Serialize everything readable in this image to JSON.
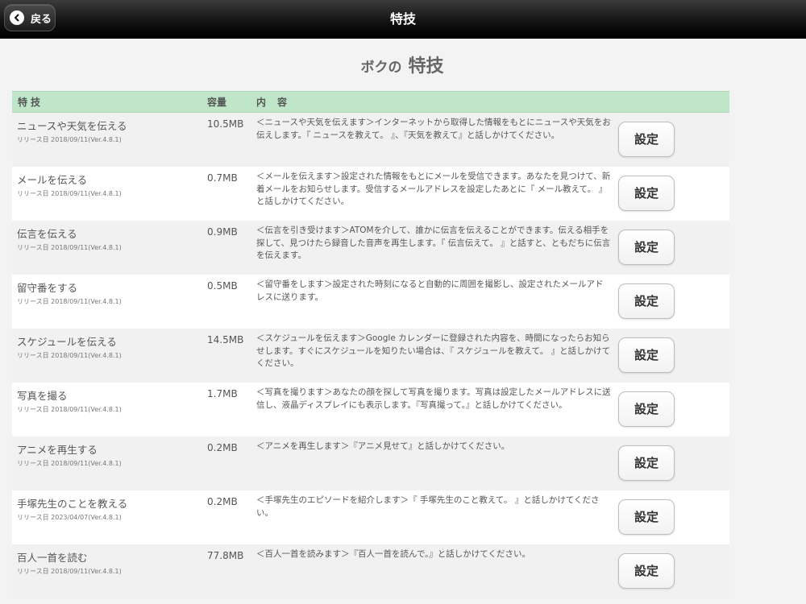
{
  "header": {
    "back_label": "戻る",
    "title": "特技"
  },
  "page_heading": {
    "sub": "ボクの",
    "main": "特技"
  },
  "table": {
    "columns": {
      "name": "特技",
      "size": "容量",
      "desc": "内容"
    },
    "setting_label": "設定",
    "rows": [
      {
        "name": "ニュースや天気を伝える",
        "release": "リリース日 2018/09/11(Ver.4.8.1)",
        "size": "10.5MB",
        "desc": "＜ニュースや天気を伝えます＞インターネットから取得した情報をもとにニュースや天気をお伝えします。『 ニュースを教えて。 』、『天気を教えて』と話しかけてください。"
      },
      {
        "name": "メールを伝える",
        "release": "リリース日 2018/09/11(Ver.4.8.1)",
        "size": "0.7MB",
        "desc": "＜メールを伝えます＞設定された情報をもとにメールを受信できます。あなたを見つけて、新着メールをお知らせします。受信するメールアドレスを設定したあとに『 メール教えて。 』と話しかけてください。"
      },
      {
        "name": "伝言を伝える",
        "release": "リリース日 2018/09/11(Ver.4.8.1)",
        "size": "0.9MB",
        "desc": "＜伝言を引き受けます＞ATOMを介して、誰かに伝言を伝えることができます。伝える相手を探して、見つけたら録音した音声を再生します。『 伝言伝えて。 』と話すと、ともだちに伝言を伝えます。"
      },
      {
        "name": "留守番をする",
        "release": "リリース日 2018/09/11(Ver.4.8.1)",
        "size": "0.5MB",
        "desc": "＜留守番をします＞設定された時刻になると自動的に周囲を撮影し、設定されたメールアドレスに送ります。"
      },
      {
        "name": "スケジュールを伝える",
        "release": "リリース日 2018/09/11(Ver.4.8.1)",
        "size": "14.5MB",
        "desc": "＜スケジュールを伝えます＞Google カレンダーに登録された内容を、時間になったらお知らせします。すぐにスケジュールを知りたい場合は、『 スケジュールを教えて。 』と話しかけてください。"
      },
      {
        "name": "写真を撮る",
        "release": "リリース日 2018/09/11(Ver.4.8.1)",
        "size": "1.7MB",
        "desc": "＜写真を撮ります＞あなたの顔を探して写真を撮ります。写真は設定したメールアドレスに送信し、液晶ディスプレイにも表示します。『写真撮って。』と話しかけてください。"
      },
      {
        "name": "アニメを再生する",
        "release": "リリース日 2018/09/11(Ver.4.8.1)",
        "size": "0.2MB",
        "desc": "＜アニメを再生します＞『アニメ見せて』と話しかけてください。"
      },
      {
        "name": "手塚先生のことを教える",
        "release": "リリース日 2023/04/07(Ver.4.8.1)",
        "size": "0.2MB",
        "desc": "＜手塚先生のエピソードを紹介します＞『 手塚先生のこと教えて。 』と話しかけてください。"
      },
      {
        "name": "百人一首を読む",
        "release": "リリース日 2018/09/11(Ver.4.8.1)",
        "size": "77.8MB",
        "desc": "＜百人一首を読みます＞『百人一首を読んで。』と話しかけてください。"
      }
    ]
  },
  "colors": {
    "header_green": "#bfe6c8",
    "topbar": "#111111"
  },
  "icons": {
    "back": "chevron-left-icon"
  }
}
